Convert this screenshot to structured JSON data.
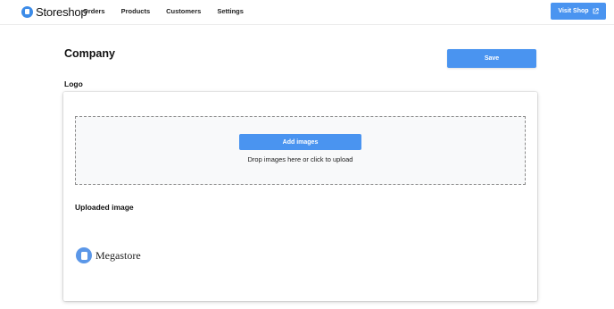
{
  "brand": {
    "name": "Storeshop",
    "icon": "shopping-bag-icon",
    "color": "#3d8ce8"
  },
  "nav": {
    "items": [
      {
        "label": "Orders"
      },
      {
        "label": "Products"
      },
      {
        "label": "Customers"
      },
      {
        "label": "Settings"
      }
    ],
    "visit_label": "Visit Shop",
    "visit_icon": "external-link-icon"
  },
  "page": {
    "title": "Company",
    "save_label": "Save"
  },
  "logo_section": {
    "title": "Logo",
    "add_label": "Add images",
    "drop_hint": "Drop images here or click to upload",
    "uploaded_title": "Uploaded image",
    "uploaded_logo_text": "Megastore"
  },
  "colors": {
    "accent": "#4a94f0",
    "dropzone_bg": "#f8f9fa"
  }
}
